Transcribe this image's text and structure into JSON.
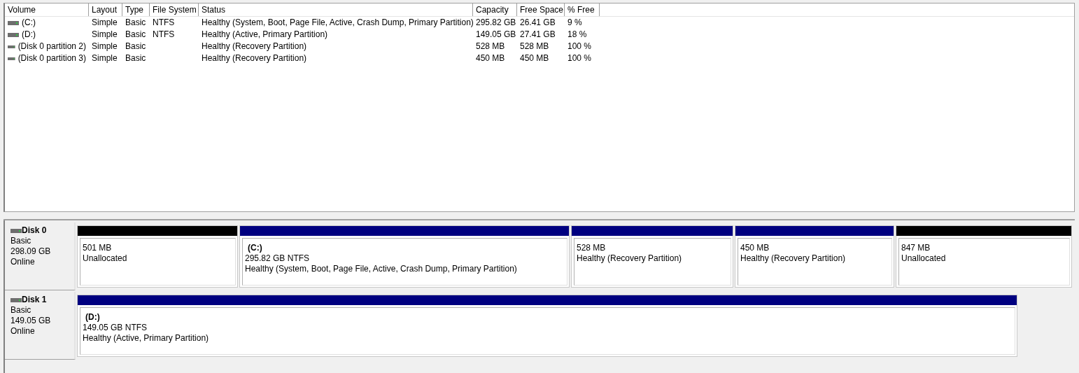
{
  "volume_list": {
    "columns": [
      "Volume",
      "Layout",
      "Type",
      "File System",
      "Status",
      "Capacity",
      "Free Space",
      "% Free"
    ],
    "rows": [
      {
        "cells": [
          "(C:)",
          "Simple",
          "Basic",
          "NTFS",
          "Healthy (System, Boot, Page File, Active, Crash Dump, Primary Partition)",
          "295.82 GB",
          "26.41 GB",
          "9 %"
        ]
      },
      {
        "cells": [
          "(D:)",
          "Simple",
          "Basic",
          "NTFS",
          "Healthy (Active, Primary Partition)",
          "149.05 GB",
          "27.41 GB",
          "18 %"
        ]
      },
      {
        "cells": [
          "(Disk 0 partition 2)",
          "Simple",
          "Basic",
          "",
          "Healthy (Recovery Partition)",
          "528 MB",
          "528 MB",
          "100 %"
        ]
      },
      {
        "cells": [
          "(Disk 0 partition 3)",
          "Simple",
          "Basic",
          "",
          "Healthy (Recovery Partition)",
          "450 MB",
          "450 MB",
          "100 %"
        ]
      }
    ]
  },
  "disks": [
    {
      "name": "Disk 0",
      "type": "Basic",
      "size": "298.09 GB",
      "status": "Online",
      "partitions": [
        {
          "kind": "unallocated",
          "size": "501 MB",
          "status": "Unallocated"
        },
        {
          "kind": "primary",
          "label": "(C:)",
          "size": "295.82 GB NTFS",
          "status": "Healthy (System, Boot, Page File, Active, Crash Dump, Primary Partition)"
        },
        {
          "kind": "primary",
          "size": "528 MB",
          "status": "Healthy (Recovery Partition)"
        },
        {
          "kind": "primary",
          "size": "450 MB",
          "status": "Healthy (Recovery Partition)"
        },
        {
          "kind": "unallocated",
          "size": "847 MB",
          "status": "Unallocated"
        }
      ]
    },
    {
      "name": "Disk 1",
      "type": "Basic",
      "size": "149.05 GB",
      "status": "Online",
      "partitions": [
        {
          "kind": "primary",
          "label": "(D:)",
          "size": "149.05 GB NTFS",
          "status": "Healthy (Active, Primary Partition)"
        }
      ]
    }
  ]
}
